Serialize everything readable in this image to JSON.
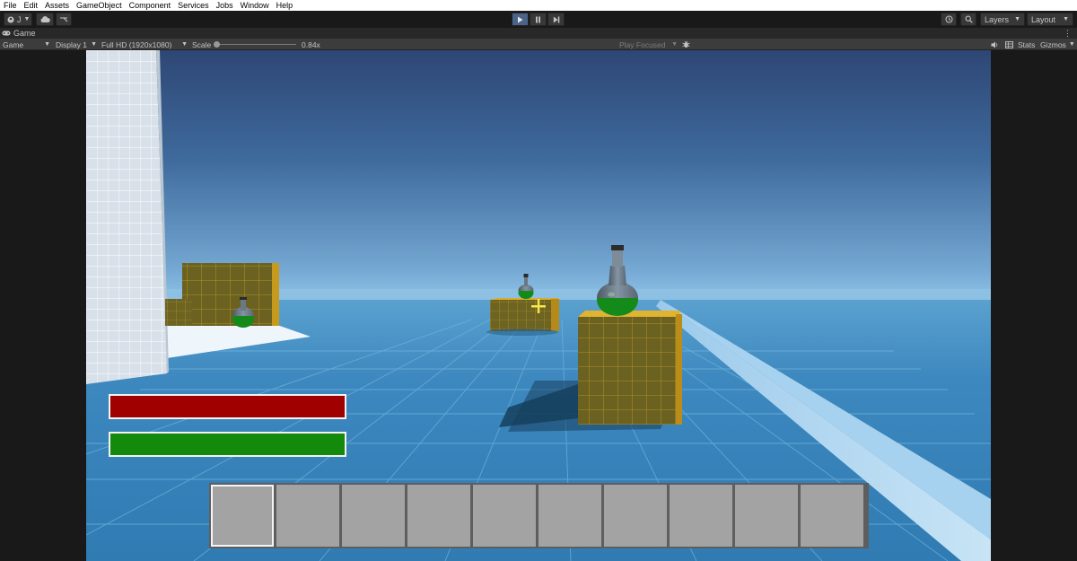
{
  "menu": [
    "File",
    "Edit",
    "Assets",
    "GameObject",
    "Component",
    "Services",
    "Jobs",
    "Window",
    "Help"
  ],
  "toolbar": {
    "account_label": "J",
    "layers_label": "Layers",
    "layout_label": "Layout",
    "play_active": true
  },
  "tab": {
    "title": "Game",
    "menu_glyph": "⋮"
  },
  "gamebar": {
    "mode": "Game",
    "display": "Display 1",
    "resolution": "Full HD (1920x1080)",
    "scale_label": "Scale",
    "scale_value": "0.84x",
    "play_focused": "Play Focused",
    "stats": "Stats",
    "gizmos": "Gizmos"
  },
  "hud": {
    "health_fill": 1.0,
    "stamina_fill": 1.0,
    "health_color": "#a10000",
    "stamina_color": "#138a0b",
    "hotbar_slots": 10,
    "selected_slot": 0
  },
  "colors": {
    "editor_bg": "#191919",
    "play_active": "#4a6489",
    "sky_top": "#2c4a7a",
    "floor": "#3a88c0",
    "crate": "#6b6120",
    "potion_liquid": "#138a1a"
  },
  "icons": [
    "account-icon",
    "cloud-icon",
    "collab-icon",
    "play-icon",
    "pause-icon",
    "step-icon",
    "history-icon",
    "search-icon",
    "gamepad-icon",
    "audio-icon",
    "stats-icon",
    "bug-icon"
  ]
}
